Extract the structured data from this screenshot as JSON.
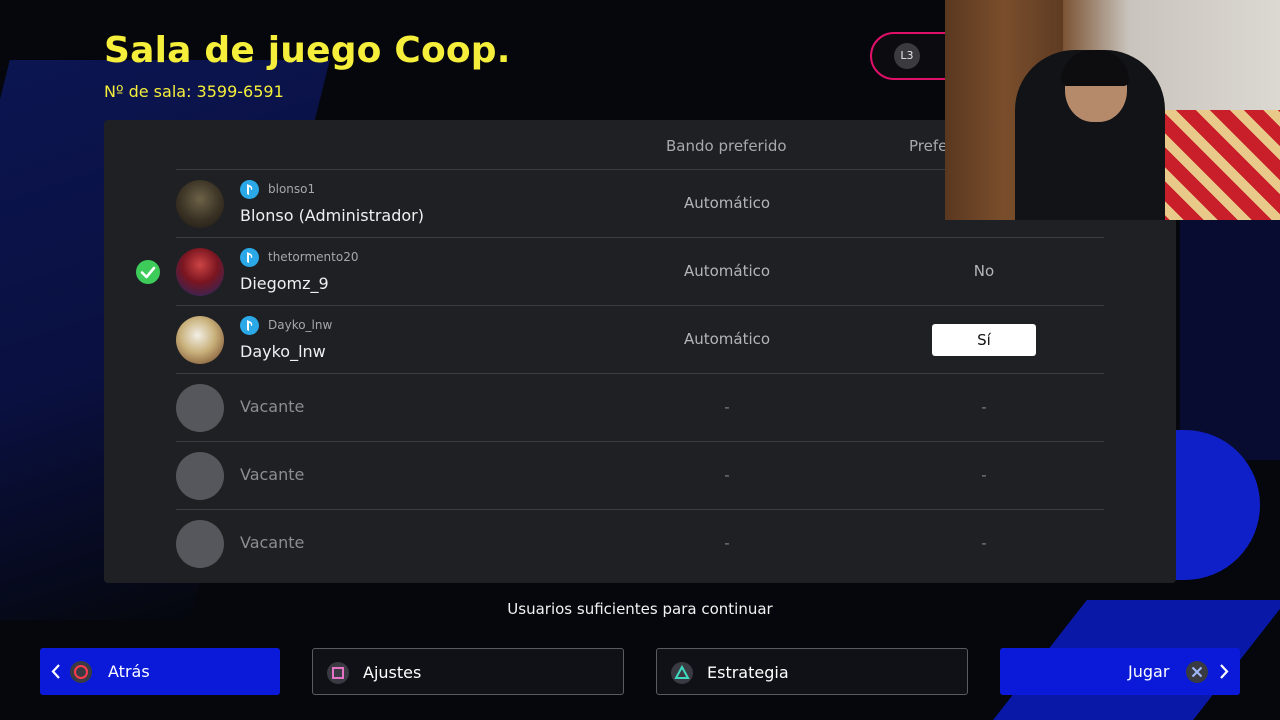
{
  "header": {
    "title": "Sala de juego Coop.",
    "room_label": "Nº de sala: 3599-6591",
    "l3_button": "L3"
  },
  "table": {
    "columns": [
      "Bando preferido",
      "Prefe"
    ],
    "rows": [
      {
        "psn_id": "blonso1",
        "name": "Blonso (Administrador)",
        "side": "Automático",
        "pref": "",
        "ready": false,
        "avatar": "player-avatar"
      },
      {
        "psn_id": "thetormento20",
        "name": "Diegomz_9",
        "side": "Automático",
        "pref": "No",
        "ready": true,
        "avatar": "player-avatar"
      },
      {
        "psn_id": "Dayko_lnw",
        "name": "Dayko_lnw",
        "side": "Automático",
        "pref": "Sí",
        "ready": false,
        "selected": true,
        "avatar": "player-avatar"
      },
      {
        "vacant": "Vacante",
        "side": "-",
        "pref": "-"
      },
      {
        "vacant": "Vacante",
        "side": "-",
        "pref": "-"
      },
      {
        "vacant": "Vacante",
        "side": "-",
        "pref": "-"
      }
    ]
  },
  "status_message": "Usuarios suficientes para continuar",
  "footer": {
    "back_label": "Atrás",
    "settings_label": "Ajustes",
    "strategy_label": "Estrategia",
    "play_label": "Jugar"
  },
  "icons": {
    "back": "circle-button-icon",
    "settings": "square-button-icon",
    "strategy": "triangle-button-icon",
    "play": "cross-button-icon",
    "psn": "playstation-icon"
  },
  "colors": {
    "title": "#f5ee3a",
    "accent_blue": "#0a1ad8",
    "l3_border": "#e0106a",
    "ready_check": "#3dcb5a",
    "psn_badge": "#2aa8e8"
  }
}
